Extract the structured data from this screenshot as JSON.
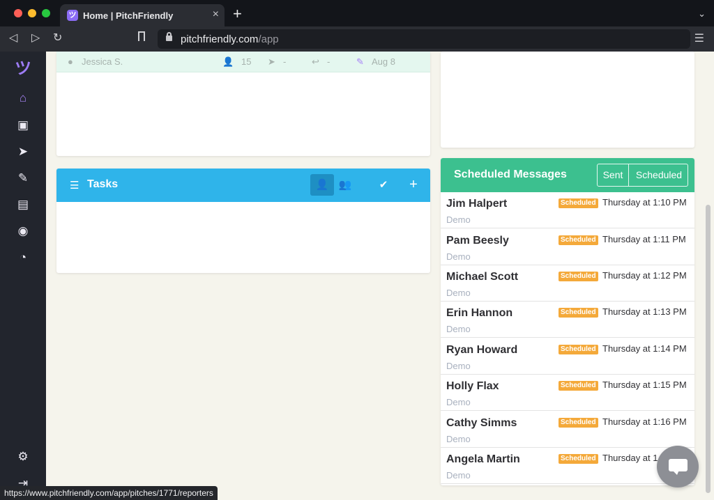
{
  "browser": {
    "tab_title": "Home | PitchFriendly",
    "tab_favicon": "ツ",
    "url_host": "pitchfriendly.com",
    "url_path": "/app"
  },
  "sidebar": {
    "logo": "ツ",
    "icons": [
      "home-icon",
      "briefcase-icon",
      "paper-plane-icon",
      "user-edit-icon",
      "newspaper-icon",
      "users-icon",
      "dashboard-icon",
      "gear-icon",
      "logout-icon"
    ]
  },
  "pitch_row": {
    "user": "Jessica S.",
    "reporters": "15",
    "sent": "-",
    "replies": "-",
    "date": "Aug 8"
  },
  "tasks": {
    "title": "Tasks"
  },
  "scheduled": {
    "title": "Scheduled Messages",
    "toggle_sent": "Sent",
    "toggle_scheduled": "Scheduled",
    "accent_color": "#3cc08f",
    "badge_color": "#f4a93a",
    "messages": [
      {
        "name": "Jim Halpert",
        "org": "Demo",
        "badge": "Scheduled",
        "time": "Thursday at 1:10 PM"
      },
      {
        "name": "Pam Beesly",
        "org": "Demo",
        "badge": "Scheduled",
        "time": "Thursday at 1:11 PM"
      },
      {
        "name": "Michael Scott",
        "org": "Demo",
        "badge": "Scheduled",
        "time": "Thursday at 1:12 PM"
      },
      {
        "name": "Erin Hannon",
        "org": "Demo",
        "badge": "Scheduled",
        "time": "Thursday at 1:13 PM"
      },
      {
        "name": "Ryan Howard",
        "org": "Demo",
        "badge": "Scheduled",
        "time": "Thursday at 1:14 PM"
      },
      {
        "name": "Holly Flax",
        "org": "Demo",
        "badge": "Scheduled",
        "time": "Thursday at 1:15 PM"
      },
      {
        "name": "Cathy Simms",
        "org": "Demo",
        "badge": "Scheduled",
        "time": "Thursday at 1:16 PM"
      },
      {
        "name": "Angela Martin",
        "org": "Demo",
        "badge": "Scheduled",
        "time": "Thursday at 1"
      }
    ]
  },
  "status_bar": {
    "link": "https://www.pitchfriendly.com/app/pitches/1771/reporters"
  }
}
